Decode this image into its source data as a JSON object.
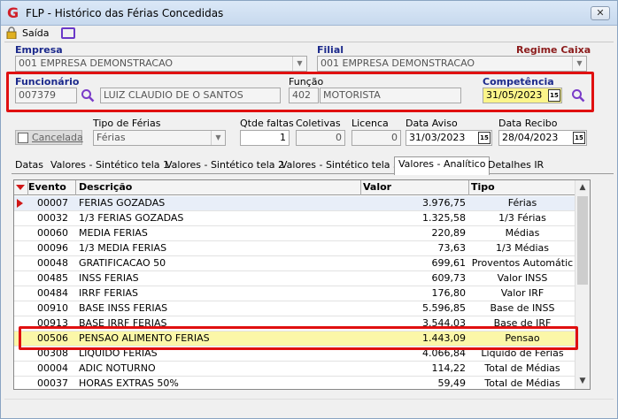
{
  "window": {
    "title": "FLP - Histórico das Férias Concedidas",
    "close_label": "✕"
  },
  "toolbar": {
    "saida_label": "Saída"
  },
  "empresa": {
    "label": "Empresa",
    "value": "001 EMPRESA DEMONSTRACAO"
  },
  "filial": {
    "label": "Filial",
    "value": "001 EMPRESA DEMONSTRACAO"
  },
  "regime": {
    "label": "Regime Caixa"
  },
  "funcionario": {
    "label": "Funcionário",
    "code": "007379",
    "name": "LUIZ CLAUDIO DE O SANTOS"
  },
  "funcao": {
    "label": "Função",
    "code": "402",
    "name": "MOTORISTA"
  },
  "competencia": {
    "label": "Competência",
    "value": "31/05/2023"
  },
  "cancelada": {
    "label": "Cancelada"
  },
  "tipo_ferias": {
    "label": "Tipo de Férias",
    "value": "Férias"
  },
  "qtde_faltas": {
    "label": "Qtde faltas",
    "value": "1"
  },
  "coletivas": {
    "label": "Coletivas",
    "value": "0"
  },
  "licenca": {
    "label": "Licenca",
    "value": "0"
  },
  "data_aviso": {
    "label": "Data Aviso",
    "value": "31/03/2023"
  },
  "data_recibo": {
    "label": "Data Recibo",
    "value": "28/04/2023"
  },
  "calendar_icon_text": "15",
  "tabs": [
    {
      "label": "Datas"
    },
    {
      "label": "Valores - Sintético tela 1"
    },
    {
      "label": "Valores - Sintético tela 2"
    },
    {
      "label": "Valores - Sintético tela 3"
    },
    {
      "label": "Valores - Analítico"
    },
    {
      "label": "Detalhes IR"
    }
  ],
  "grid": {
    "headers": {
      "evento": "Evento",
      "descricao": "Descrição",
      "valor": "Valor",
      "tipo": "Tipo"
    },
    "rows": [
      {
        "evento": "00007",
        "descricao": "FERIAS GOZADAS",
        "valor": "3.976,75",
        "tipo": "Férias"
      },
      {
        "evento": "00032",
        "descricao": "1/3 FERIAS GOZADAS",
        "valor": "1.325,58",
        "tipo": "1/3 Férias"
      },
      {
        "evento": "00060",
        "descricao": "MEDIA FERIAS",
        "valor": "220,89",
        "tipo": "Médias"
      },
      {
        "evento": "00096",
        "descricao": "1/3 MEDIA FERIAS",
        "valor": "73,63",
        "tipo": "1/3 Médias"
      },
      {
        "evento": "00048",
        "descricao": "GRATIFICACAO 50",
        "valor": "699,61",
        "tipo": "Proventos Automátic"
      },
      {
        "evento": "00485",
        "descricao": "INSS FERIAS",
        "valor": "609,73",
        "tipo": "Valor INSS"
      },
      {
        "evento": "00484",
        "descricao": "IRRF FERIAS",
        "valor": "176,80",
        "tipo": "Valor IRF"
      },
      {
        "evento": "00910",
        "descricao": "BASE INSS FERIAS",
        "valor": "5.596,85",
        "tipo": "Base de INSS"
      },
      {
        "evento": "00913",
        "descricao": "BASE IRRF FERIAS",
        "valor": "3.544,03",
        "tipo": "Base de IRF"
      },
      {
        "evento": "00506",
        "descricao": "PENSAO ALIMENTO FERIAS",
        "valor": "1.443,09",
        "tipo": "Pensao"
      },
      {
        "evento": "00308",
        "descricao": "LIQUIDO FERIAS",
        "valor": "4.066,84",
        "tipo": "Líquido de Férias"
      },
      {
        "evento": "00004",
        "descricao": "ADIC NOTURNO",
        "valor": "114,22",
        "tipo": "Total de Médias"
      },
      {
        "evento": "00037",
        "descricao": "HORAS EXTRAS 50%",
        "valor": "59,49",
        "tipo": "Total de Médias"
      }
    ]
  },
  "colors": {
    "highlight_box": "#e01010",
    "competencia_bg": "#fbf58a",
    "brand": "#d0202a"
  }
}
